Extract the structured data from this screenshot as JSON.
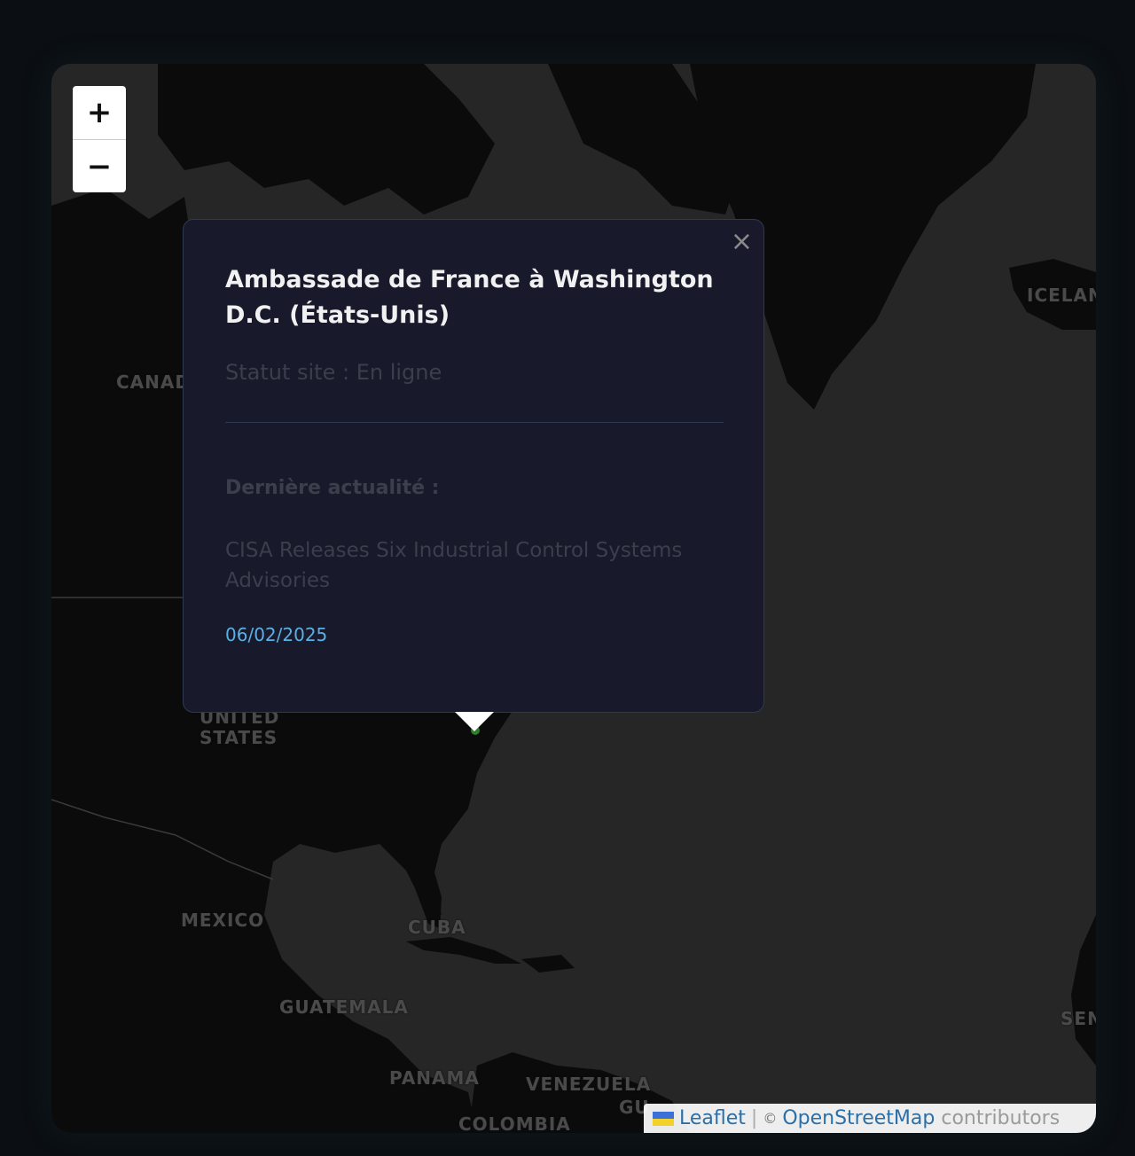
{
  "colors": {
    "page_bg": "#0b0f14",
    "ocean": "#262626",
    "land": "#0b0b0b",
    "popup_bg": "#181a2c",
    "date": "#5ab0e6",
    "link": "#2a6fa8"
  },
  "map": {
    "labels": {
      "canada": "CANADA",
      "iceland": "ICELAND",
      "united": "UNITED",
      "states": "STATES",
      "mexico": "MEXICO",
      "cuba": "CUBA",
      "guatemala": "GUATEMALA",
      "panama": "PANAMA",
      "venezuela": "VENEZUELA",
      "colombia": "COLOMBIA",
      "guyana": "GU",
      "senegal": "SEN"
    },
    "marker_icon": "map-marker-icon"
  },
  "zoom": {
    "in_label": "+",
    "out_label": "−"
  },
  "popup": {
    "close_label": "×",
    "title": "Ambassade de France à Washington D.C. (États-Unis)",
    "status": "Statut site : En ligne",
    "news_label": "Dernière actualité :",
    "news_text": "CISA Releases Six Industrial Control Systems Advisories",
    "date": "06/02/2025"
  },
  "attribution": {
    "leaflet": "Leaflet",
    "separator": "|",
    "copyright": "©",
    "osm": "OpenStreetMap",
    "contributors": "contributors",
    "flag_icon": "ukraine-flag-icon"
  }
}
